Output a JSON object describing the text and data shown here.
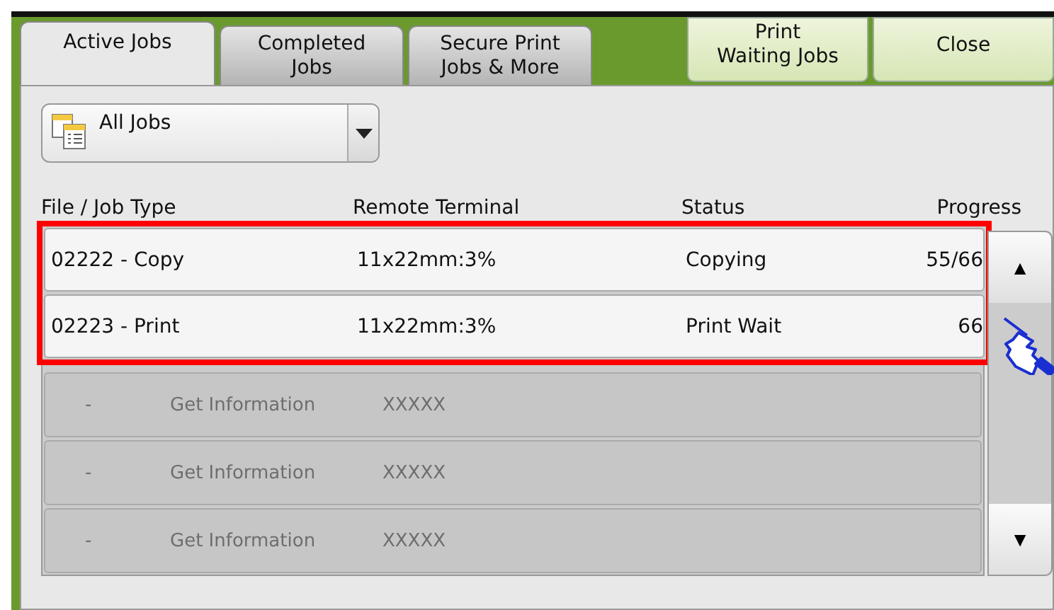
{
  "tabs": [
    {
      "label": "Active Jobs",
      "selected": true
    },
    {
      "label": "Completed\nJobs",
      "selected": false
    },
    {
      "label": "Secure Print\nJobs & More",
      "selected": false
    }
  ],
  "actions": [
    "Print\nWaiting Jobs",
    "Close"
  ],
  "filter": {
    "value": "All Jobs"
  },
  "table": {
    "columns": [
      "File / Job Type",
      "Remote Terminal",
      "Status",
      "Progress"
    ],
    "rows": [
      {
        "kind": "job",
        "file": "02222 - Copy",
        "terminal": "11x22mm:3%",
        "status": "Copying",
        "progress": "55/66",
        "highlighted": true
      },
      {
        "kind": "job",
        "file": "02223 - Print",
        "terminal": "11x22mm:3%",
        "status": "Print Wait",
        "progress": "66",
        "highlighted": true
      },
      {
        "kind": "placeholder",
        "dash": "-",
        "file": "Get Information",
        "terminal": "XXXXX",
        "highlighted": false
      },
      {
        "kind": "placeholder",
        "dash": "-",
        "file": "Get Information",
        "terminal": "XXXXX",
        "highlighted": false
      },
      {
        "kind": "placeholder",
        "dash": "-",
        "file": "Get Information",
        "terminal": "XXXXX",
        "highlighted": false
      }
    ]
  },
  "scroll": {
    "up": "▲",
    "down": "▼"
  }
}
